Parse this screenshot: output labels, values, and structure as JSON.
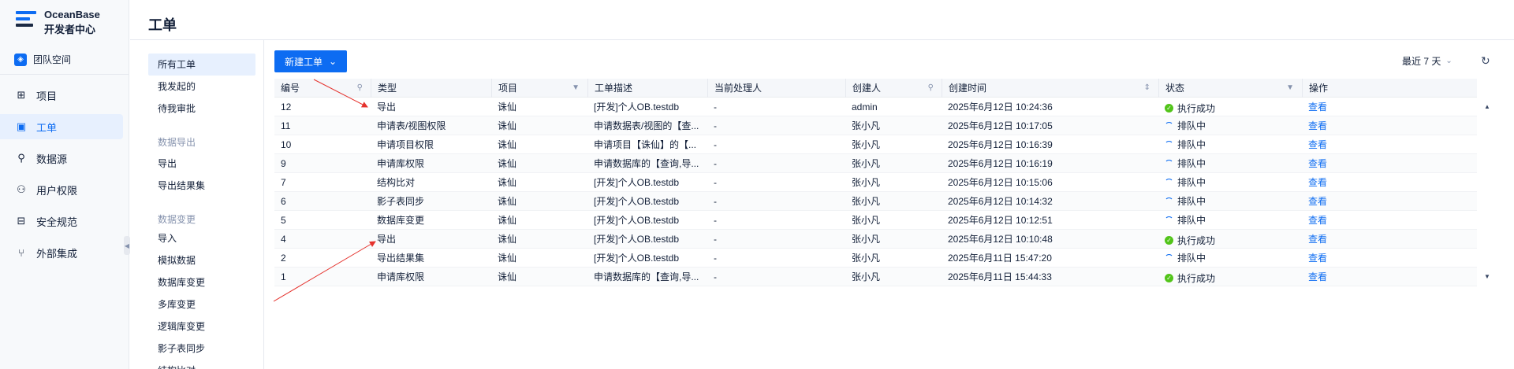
{
  "brand": {
    "name": "OceanBase",
    "sub": "开发者中心"
  },
  "space_label": "团队空间",
  "nav": [
    {
      "label": "项目",
      "icon": "grid-icon",
      "glyph": "⊞"
    },
    {
      "label": "工单",
      "icon": "briefcase-icon",
      "glyph": "▣"
    },
    {
      "label": "数据源",
      "icon": "link-icon",
      "glyph": "⚲"
    },
    {
      "label": "用户权限",
      "icon": "users-icon",
      "glyph": "⚇"
    },
    {
      "label": "安全规范",
      "icon": "shield-icon",
      "glyph": "⊟"
    },
    {
      "label": "外部集成",
      "icon": "integration-icon",
      "glyph": "⑂"
    }
  ],
  "page_title": "工单",
  "submenu": {
    "items_top": [
      "所有工单",
      "我发起的",
      "待我审批"
    ],
    "group_export": "数据导出",
    "items_export": [
      "导出",
      "导出结果集"
    ],
    "group_change": "数据变更",
    "items_change": [
      "导入",
      "模拟数据",
      "数据库变更",
      "多库变更",
      "逻辑库变更",
      "影子表同步",
      "结构比对"
    ]
  },
  "toolbar": {
    "new_label": "新建工单",
    "range_label": "最近 7 天"
  },
  "columns": [
    "编号",
    "类型",
    "项目",
    "工单描述",
    "当前处理人",
    "创建人",
    "创建时间",
    "状态",
    "操作"
  ],
  "rows": [
    {
      "id": "12",
      "type": "导出",
      "project": "诛仙",
      "desc": "[开发]个人OB.testdb",
      "handler": "-",
      "creator": "admin",
      "time": "2025年6月12日 10:24:36",
      "status": "执行成功",
      "ok": true,
      "action": "查看"
    },
    {
      "id": "11",
      "type": "申请表/视图权限",
      "project": "诛仙",
      "desc": "申请数据表/视图的【查...",
      "handler": "-",
      "creator": "张小凡",
      "time": "2025年6月12日 10:17:05",
      "status": "排队中",
      "ok": false,
      "action": "查看"
    },
    {
      "id": "10",
      "type": "申请项目权限",
      "project": "诛仙",
      "desc": "申请项目【诛仙】的【...",
      "handler": "-",
      "creator": "张小凡",
      "time": "2025年6月12日 10:16:39",
      "status": "排队中",
      "ok": false,
      "action": "查看"
    },
    {
      "id": "9",
      "type": "申请库权限",
      "project": "诛仙",
      "desc": "申请数据库的【查询,导...",
      "handler": "-",
      "creator": "张小凡",
      "time": "2025年6月12日 10:16:19",
      "status": "排队中",
      "ok": false,
      "action": "查看"
    },
    {
      "id": "7",
      "type": "结构比对",
      "project": "诛仙",
      "desc": "[开发]个人OB.testdb",
      "handler": "-",
      "creator": "张小凡",
      "time": "2025年6月12日 10:15:06",
      "status": "排队中",
      "ok": false,
      "action": "查看"
    },
    {
      "id": "6",
      "type": "影子表同步",
      "project": "诛仙",
      "desc": "[开发]个人OB.testdb",
      "handler": "-",
      "creator": "张小凡",
      "time": "2025年6月12日 10:14:32",
      "status": "排队中",
      "ok": false,
      "action": "查看"
    },
    {
      "id": "5",
      "type": "数据库变更",
      "project": "诛仙",
      "desc": "[开发]个人OB.testdb",
      "handler": "-",
      "creator": "张小凡",
      "time": "2025年6月12日 10:12:51",
      "status": "排队中",
      "ok": false,
      "action": "查看"
    },
    {
      "id": "4",
      "type": "导出",
      "project": "诛仙",
      "desc": "[开发]个人OB.testdb",
      "handler": "-",
      "creator": "张小凡",
      "time": "2025年6月12日 10:10:48",
      "status": "执行成功",
      "ok": true,
      "action": "查看"
    },
    {
      "id": "2",
      "type": "导出结果集",
      "project": "诛仙",
      "desc": "[开发]个人OB.testdb",
      "handler": "-",
      "creator": "张小凡",
      "time": "2025年6月11日 15:47:20",
      "status": "排队中",
      "ok": false,
      "action": "查看"
    },
    {
      "id": "1",
      "type": "申请库权限",
      "project": "诛仙",
      "desc": "申请数据库的【查询,导...",
      "handler": "-",
      "creator": "张小凡",
      "time": "2025年6月11日 15:44:33",
      "status": "执行成功",
      "ok": true,
      "action": "查看"
    }
  ],
  "colors": {
    "primary": "#0d6cf2",
    "success": "#52c41a",
    "annotation": "#e5322d"
  }
}
